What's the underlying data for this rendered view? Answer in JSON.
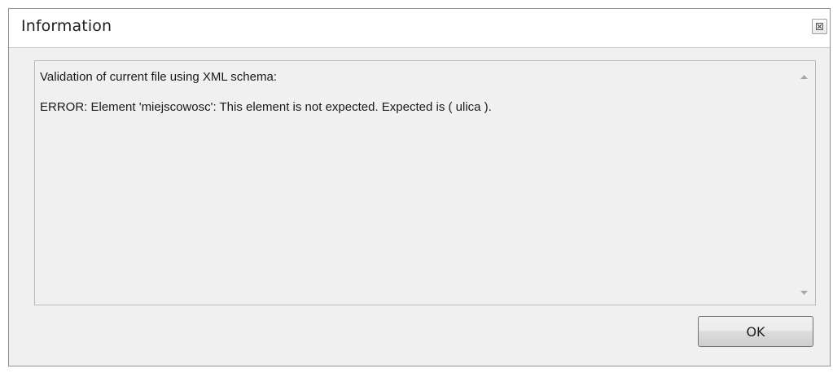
{
  "dialog": {
    "title": "Information",
    "close_icon": "close-icon",
    "message": {
      "line1": "Validation of current file using XML schema:",
      "line2": "ERROR: Element 'miejscowosc': This element is not expected. Expected is ( ulica )."
    },
    "scrollbar": {
      "up_icon": "scroll-up-arrow-icon",
      "down_icon": "scroll-down-arrow-icon"
    },
    "ok_label": "OK"
  }
}
